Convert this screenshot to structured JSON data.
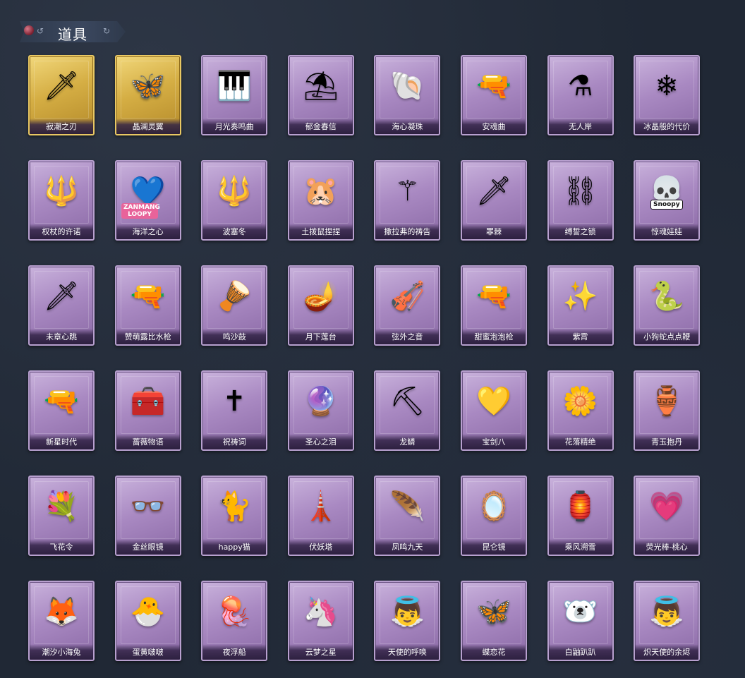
{
  "header": {
    "title": "道具",
    "left_swirl": "↺",
    "right_swirl": "↻"
  },
  "badges": {
    "loopy": "ZANMANG LOOPY",
    "snoopy": "Snoopy"
  },
  "items": [
    {
      "name": "寂潮之刃",
      "icon": "🗡",
      "rarity": "gold"
    },
    {
      "name": "晶澜灵翼",
      "icon": "🦋",
      "rarity": "gold"
    },
    {
      "name": "月光奏鸣曲",
      "icon": "🎹",
      "rarity": "purple"
    },
    {
      "name": "郁金春信",
      "icon": "⛱",
      "rarity": "purple"
    },
    {
      "name": "海心凝珠",
      "icon": "🐚",
      "rarity": "purple"
    },
    {
      "name": "安魂曲",
      "icon": "🔫",
      "rarity": "purple"
    },
    {
      "name": "无人岸",
      "icon": "⚗",
      "rarity": "purple"
    },
    {
      "name": "冰晶般的代价",
      "icon": "❄",
      "rarity": "purple"
    },
    {
      "name": "权杖的许诺",
      "icon": "🔱",
      "rarity": "purple"
    },
    {
      "name": "海洋之心",
      "icon": "💙",
      "rarity": "purple"
    },
    {
      "name": "波塞冬",
      "icon": "🔱",
      "rarity": "purple"
    },
    {
      "name": "土拨鼠捏捏",
      "icon": "🐹",
      "rarity": "purple"
    },
    {
      "name": "撒拉弗的祷告",
      "icon": "⚚",
      "rarity": "purple"
    },
    {
      "name": "罪棘",
      "icon": "🗡",
      "rarity": "purple"
    },
    {
      "name": "缚誓之锁",
      "icon": "⛓",
      "rarity": "purple"
    },
    {
      "name": "惊魂娃娃",
      "icon": "💀",
      "rarity": "purple"
    },
    {
      "name": "未章心跳",
      "icon": "🗡",
      "rarity": "purple"
    },
    {
      "name": "赞萌露比水枪",
      "icon": "🔫",
      "rarity": "purple"
    },
    {
      "name": "鸣沙鼓",
      "icon": "🪘",
      "rarity": "purple"
    },
    {
      "name": "月下莲台",
      "icon": "🪔",
      "rarity": "purple"
    },
    {
      "name": "弦外之音",
      "icon": "🎻",
      "rarity": "purple"
    },
    {
      "name": "甜蜜泡泡枪",
      "icon": "🔫",
      "rarity": "purple"
    },
    {
      "name": "紫霄",
      "icon": "✨",
      "rarity": "purple"
    },
    {
      "name": "小狗蛇点点鞭",
      "icon": "🐍",
      "rarity": "purple"
    },
    {
      "name": "新星时代",
      "icon": "🔫",
      "rarity": "purple"
    },
    {
      "name": "蔷薇物语",
      "icon": "🧰",
      "rarity": "purple"
    },
    {
      "name": "祝祷词",
      "icon": "✝",
      "rarity": "purple"
    },
    {
      "name": "圣心之泪",
      "icon": "🔮",
      "rarity": "purple"
    },
    {
      "name": "龙鳞",
      "icon": "⛏",
      "rarity": "purple"
    },
    {
      "name": "宝剑八",
      "icon": "💛",
      "rarity": "purple"
    },
    {
      "name": "花落精绝",
      "icon": "🌼",
      "rarity": "purple"
    },
    {
      "name": "青玉抱丹",
      "icon": "🏺",
      "rarity": "purple"
    },
    {
      "name": "飞花令",
      "icon": "💐",
      "rarity": "purple"
    },
    {
      "name": "金丝眼镜",
      "icon": "👓",
      "rarity": "purple"
    },
    {
      "name": "happy猫",
      "icon": "🐈",
      "rarity": "purple"
    },
    {
      "name": "伏妖塔",
      "icon": "🗼",
      "rarity": "purple"
    },
    {
      "name": "凤鸣九天",
      "icon": "🪶",
      "rarity": "purple"
    },
    {
      "name": "昆仑镜",
      "icon": "🪞",
      "rarity": "purple"
    },
    {
      "name": "乘风溯雪",
      "icon": "🏮",
      "rarity": "purple"
    },
    {
      "name": "荧光棒-桃心",
      "icon": "💗",
      "rarity": "purple"
    },
    {
      "name": "潮汐小海兔",
      "icon": "🦊",
      "rarity": "purple"
    },
    {
      "name": "蛋黄啵啵",
      "icon": "🐣",
      "rarity": "purple"
    },
    {
      "name": "夜浮船",
      "icon": "🪼",
      "rarity": "purple"
    },
    {
      "name": "云梦之星",
      "icon": "🦄",
      "rarity": "purple"
    },
    {
      "name": "天使的呼唤",
      "icon": "👼",
      "rarity": "purple"
    },
    {
      "name": "蝶恋花",
      "icon": "🦋",
      "rarity": "purple"
    },
    {
      "name": "白鼬趴趴",
      "icon": "🐻‍❄️",
      "rarity": "purple"
    },
    {
      "name": "炽天使的余烬",
      "icon": "👼",
      "rarity": "purple"
    }
  ]
}
